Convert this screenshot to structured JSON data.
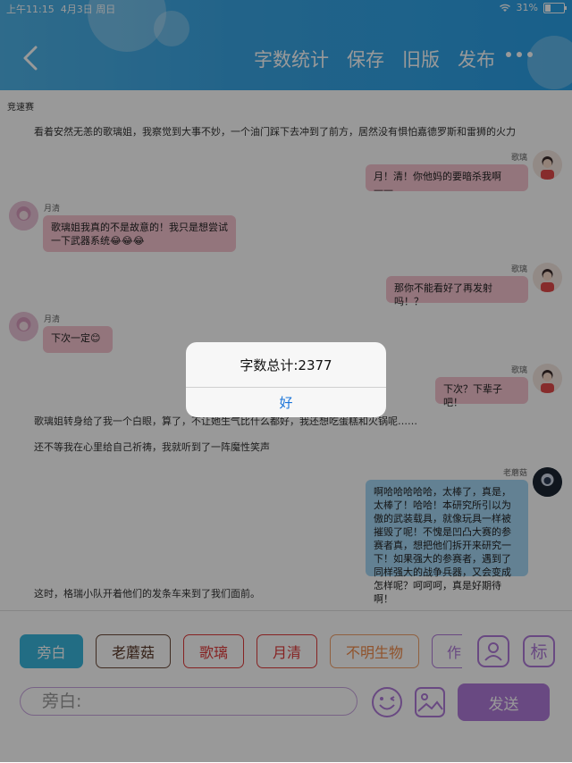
{
  "status": {
    "time": "上午11:15",
    "date": "4月3日 周日",
    "battery": "31%"
  },
  "header": {
    "actions": [
      "字数统计",
      "保存",
      "旧版",
      "发布"
    ]
  },
  "content": {
    "tag": "竞速赛",
    "narration1": "看着安然无恙的歌璃姐，我察觉到大事不妙，一个油门踩下去冲到了前方，居然没有惧怕嘉德罗斯和雷狮的火力",
    "msg1": {
      "speaker": "歌璃",
      "text": "月！清！你他妈的要暗杀我啊——"
    },
    "msg2": {
      "speaker": "月清",
      "text": "歌璃姐我真的不是故意的！我只是想尝试一下武器系统😂😂😂"
    },
    "msg3": {
      "speaker": "歌璃",
      "text": "那你不能看好了再发射吗！？"
    },
    "msg4": {
      "speaker": "月清",
      "text": "下次一定😊"
    },
    "msg5": {
      "speaker": "歌璃",
      "text": "下次？下辈子吧！"
    },
    "narration2": "歌璃姐转身给了我一个白眼，算了，不让她生气比什么都好，我还想吃蛋糕和火锅呢……",
    "narration3": "还不等我在心里给自己祈祷，我就听到了一阵魔性笑声",
    "msg6": {
      "speaker": "老蘑菇",
      "text": "啊哈哈哈哈哈，太棒了，真是，太棒了！哈哈！本研究所引以为傲的武装载具，就像玩具一样被摧毁了呢！不愧是凹凸大赛的参赛者真，想把他们拆开来研究一下！如果强大的参赛者，遇到了同样强大的战争兵器，又会变成怎样呢？呵呵呵，真是好期待啊！"
    },
    "narration4": "这时，格瑞小队开着他们的发条车来到了我们面前。"
  },
  "dialog": {
    "message": "字数总计:2377",
    "ok": "好"
  },
  "bottom": {
    "chips": [
      "旁白",
      "老蘑菇",
      "歌璃",
      "月清",
      "不明生物",
      "作"
    ],
    "input_placeholder": "旁白:",
    "send": "发送",
    "icons": [
      "user-icon",
      "label-icon",
      "emoji-icon",
      "image-icon"
    ]
  },
  "colors": {
    "accent_blue": "#2aa0e6",
    "purple": "#b07bd9",
    "pink_bubble": "#f6c3cf",
    "blue_bubble": "#a6d7f5"
  }
}
